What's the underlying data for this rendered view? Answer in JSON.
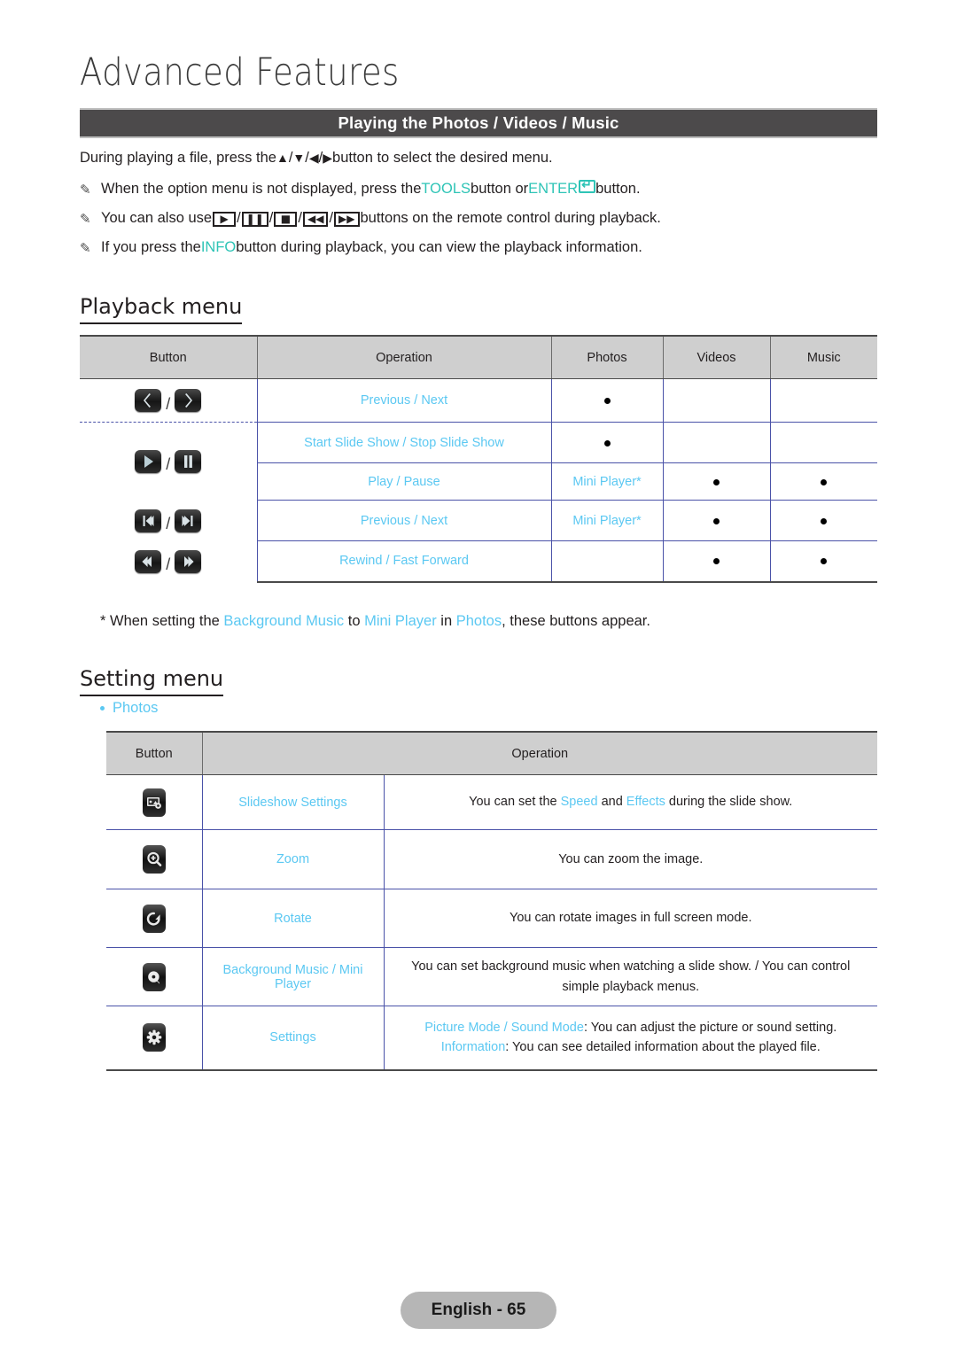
{
  "page": {
    "chapter_title": "Advanced Features",
    "section_bar_title": "Playing the Photos / Videos / Music",
    "footer_label": "English - 65"
  },
  "colors": {
    "accent_cyan": "#5bc8f2",
    "accent_teal": "#2ec4b6",
    "section_bar_bg": "#4c4a4b",
    "table_header_bg": "#cfcfcf",
    "table_inner_border": "#4a52a8",
    "footer_pill_bg": "#b6b6b6"
  },
  "intro": {
    "line1": {
      "prefix": "During playing a file, press the ",
      "arrows": [
        "▲",
        "▼",
        "◀",
        "▶"
      ],
      "suffix": " button to select the desired menu."
    },
    "line2": {
      "prefix": "When the option menu is not displayed, press the ",
      "tools": "TOOLS",
      "middle": " button or ",
      "enter": "ENTER",
      "suffix": " button."
    },
    "line3": {
      "prefix": "You can also use ",
      "keys": [
        "▶",
        "❙❙",
        "■",
        "◀◀",
        "▶▶"
      ],
      "suffix": " buttons on the remote control during playback."
    },
    "line4": {
      "prefix": "If you press the ",
      "info": "INFO",
      "suffix": " button during playback, you can view the playback information."
    }
  },
  "playback": {
    "heading": "Playback menu",
    "columns": [
      "Button",
      "Operation",
      "Photos",
      "Videos",
      "Music"
    ],
    "rows": [
      {
        "button_icons": [
          "chevron-left",
          "chevron-right"
        ],
        "operation": "Previous / Next",
        "photos": "dot",
        "videos": "",
        "music": ""
      },
      {
        "button_icons": [
          "play",
          "pause"
        ],
        "operation": "Start Slide Show / Stop Slide Show",
        "photos": "dot",
        "videos": "",
        "music": ""
      },
      {
        "button_icons": [],
        "operation": "Play / Pause",
        "photos": "Mini Player*",
        "videos": "dot",
        "music": "dot"
      },
      {
        "button_icons": [
          "skip-back",
          "skip-forward"
        ],
        "operation": "Previous / Next",
        "photos": "Mini Player*",
        "videos": "dot",
        "music": "dot"
      },
      {
        "button_icons": [
          "rewind",
          "fast-forward"
        ],
        "operation": "Rewind / Fast Forward",
        "photos": "",
        "videos": "dot",
        "music": "dot"
      }
    ],
    "footnote": {
      "prefix": "* When setting the ",
      "bg_music": "Background Music",
      "mid1": " to ",
      "mini_player": "Mini Player",
      "mid2": " in ",
      "photos": "Photos",
      "suffix": ", these buttons appear."
    }
  },
  "setting": {
    "heading": "Setting menu",
    "bullet_label": "Photos",
    "columns": [
      "Button",
      "Operation"
    ],
    "rows": [
      {
        "icon": "slideshow-settings-icon",
        "name": "Slideshow Settings",
        "desc_parts": [
          {
            "t": "You can set the ",
            "c": "dark"
          },
          {
            "t": "Speed",
            "c": "cyan"
          },
          {
            "t": " and ",
            "c": "dark"
          },
          {
            "t": "Effects",
            "c": "cyan"
          },
          {
            "t": " during the slide show.",
            "c": "dark"
          }
        ]
      },
      {
        "icon": "zoom-icon",
        "name": "Zoom",
        "desc_parts": [
          {
            "t": "You can zoom the image.",
            "c": "dark"
          }
        ]
      },
      {
        "icon": "rotate-icon",
        "name": "Rotate",
        "desc_parts": [
          {
            "t": "You can rotate images in full screen mode.",
            "c": "dark"
          }
        ]
      },
      {
        "icon": "background-music-icon",
        "name": "Background Music / Mini Player",
        "desc_parts": [
          {
            "t": "You can set background music when watching a slide show. / You can control simple playback menus.",
            "c": "dark"
          }
        ]
      },
      {
        "icon": "settings-gear-icon",
        "name": "Settings",
        "desc_parts": [
          {
            "t": "Picture Mode / Sound Mode",
            "c": "cyan"
          },
          {
            "t": ": You can adjust the picture or sound setting.",
            "c": "dark"
          },
          {
            "t": "\n",
            "c": "br"
          },
          {
            "t": "Information",
            "c": "cyan"
          },
          {
            "t": ": You can see detailed information about the played file.",
            "c": "dark"
          }
        ]
      }
    ]
  }
}
